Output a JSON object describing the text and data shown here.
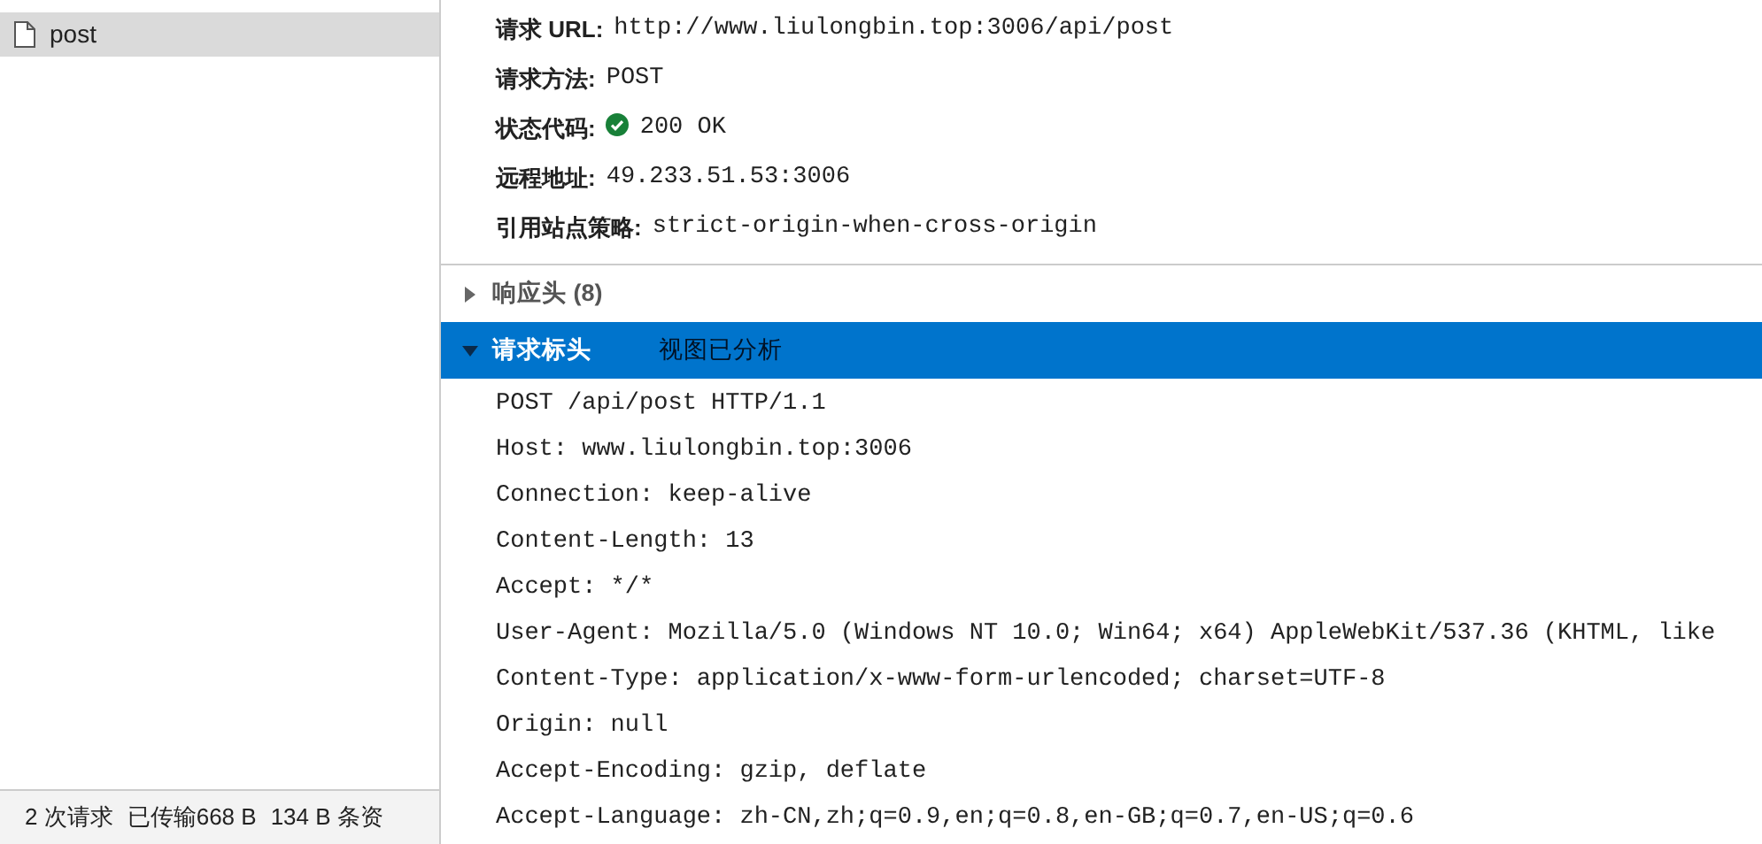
{
  "requests": [
    {
      "name": "post",
      "selected": true
    }
  ],
  "status_bar": [
    "2 次请求",
    "已传输668 B",
    "134 B 条资"
  ],
  "general": [
    {
      "label": "请求 URL:",
      "value": "http://www.liulongbin.top:3006/api/post"
    },
    {
      "label": "请求方法:",
      "value": "POST"
    },
    {
      "label": "状态代码:",
      "value": "200 OK",
      "status_ok": true
    },
    {
      "label": "远程地址:",
      "value": "49.233.51.53:3006"
    },
    {
      "label": "引用站点策略:",
      "value": "strict-origin-when-cross-origin"
    }
  ],
  "sections": [
    {
      "title": "响应头 (8)",
      "expanded": false,
      "selected": false
    },
    {
      "title": "请求标头",
      "expanded": true,
      "selected": true,
      "action": "视图已分析",
      "lines": [
        "POST /api/post HTTP/1.1",
        "Host: www.liulongbin.top:3006",
        "Connection: keep-alive",
        "Content-Length: 13",
        "Accept: */*",
        "User-Agent: Mozilla/5.0 (Windows NT 10.0; Win64; x64) AppleWebKit/537.36 (KHTML, like",
        "Content-Type: application/x-www-form-urlencoded; charset=UTF-8",
        "Origin: null",
        "Accept-Encoding: gzip, deflate",
        "Accept-Language: zh-CN,zh;q=0.9,en;q=0.8,en-GB;q=0.7,en-US;q=0.6"
      ]
    }
  ]
}
